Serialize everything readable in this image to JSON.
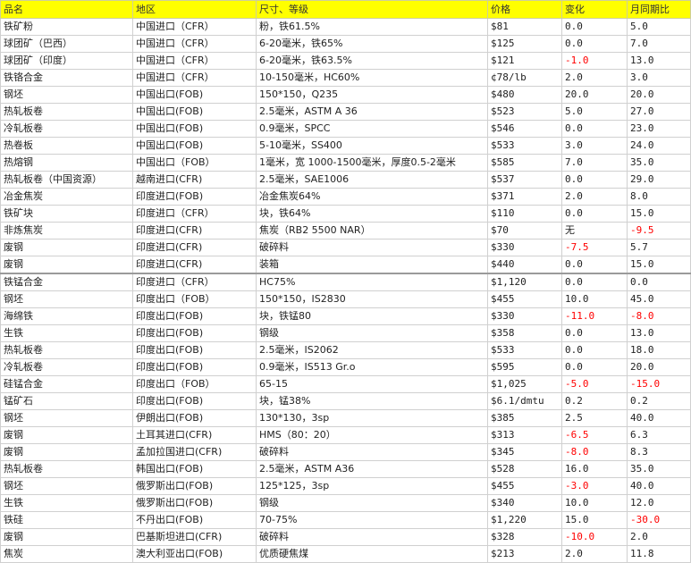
{
  "headers": [
    "品名",
    "地区",
    "尺寸、等级",
    "价格",
    "变化",
    "月同期比"
  ],
  "colors": {
    "header_bg": "#ffff00",
    "negative": "#ff0000",
    "grid": "#d0d0d0"
  },
  "rows": [
    {
      "name": "铁矿粉",
      "region": "中国进口（CFR）",
      "spec": "粉，铁61.5%",
      "price": "$81",
      "change": "0.0",
      "mom": "5.0"
    },
    {
      "name": "球团矿（巴西）",
      "region": "中国进口（CFR）",
      "spec": "6-20毫米，铁65%",
      "price": "$125",
      "change": "0.0",
      "mom": "7.0"
    },
    {
      "name": "球团矿（印度）",
      "region": "中国进口（CFR）",
      "spec": "6-20毫米，铁63.5%",
      "price": "$121",
      "change": "-1.0",
      "mom": "13.0"
    },
    {
      "name": "铁铬合金",
      "region": "中国进口（CFR）",
      "spec": "10-150毫米，HC60%",
      "price": "¢78/lb",
      "change": "2.0",
      "mom": "3.0"
    },
    {
      "name": "钢坯",
      "region": "中国出口(FOB)",
      "spec": "150*150，Q235",
      "price": "$480",
      "change": "20.0",
      "mom": "20.0"
    },
    {
      "name": "热轧板卷",
      "region": "中国出口(FOB)",
      "spec": "2.5毫米，ASTM A 36",
      "price": "$523",
      "change": "5.0",
      "mom": "27.0"
    },
    {
      "name": "冷轧板卷",
      "region": "中国出口(FOB)",
      "spec": "0.9毫米，SPCC",
      "price": "$546",
      "change": "0.0",
      "mom": "23.0"
    },
    {
      "name": "热卷板",
      "region": "中国出口(FOB)",
      "spec": "5-10毫米，SS400",
      "price": "$533",
      "change": "3.0",
      "mom": "24.0"
    },
    {
      "name": "热熔钢",
      "region": "中国出口（FOB）",
      "spec": "1毫米，宽 1000-1500毫米，厚度0.5-2毫米",
      "price": "$585",
      "change": "7.0",
      "mom": "35.0"
    },
    {
      "name": "热轧板卷（中国资源）",
      "region": "越南进口(CFR)",
      "spec": "2.5毫米，SAE1006",
      "price": "$537",
      "change": "0.0",
      "mom": "29.0"
    },
    {
      "name": "冶金焦炭",
      "region": "印度进口(FOB)",
      "spec": "冶金焦炭64%",
      "price": "$371",
      "change": "2.0",
      "mom": "8.0"
    },
    {
      "name": "铁矿块",
      "region": "印度进口（CFR）",
      "spec": "块，铁64%",
      "price": "$110",
      "change": "0.0",
      "mom": "15.0"
    },
    {
      "name": "非炼焦炭",
      "region": "印度进口(CFR)",
      "spec": "焦炭（RB2 5500 NAR）",
      "price": "$70",
      "change": "无",
      "mom": "-9.5"
    },
    {
      "name": "废钢",
      "region": "印度进口(CFR)",
      "spec": "破碎料",
      "price": "$330",
      "change": "-7.5",
      "mom": "5.7"
    },
    {
      "name": "废钢",
      "region": "印度进口(CFR)",
      "spec": "装箱",
      "price": "$440",
      "change": "0.0",
      "mom": "15.0"
    },
    {
      "name": "铁锰合金",
      "region": "印度进口（CFR）",
      "spec": "HC75%",
      "price": "$1,120",
      "change": "0.0",
      "mom": "0.0"
    },
    {
      "name": "钢坯",
      "region": "印度出口（FOB）",
      "spec": "150*150，IS2830",
      "price": "$455",
      "change": "10.0",
      "mom": "45.0"
    },
    {
      "name": "海绵铁",
      "region": "印度出口(FOB)",
      "spec": "块，铁锰80",
      "price": "$330",
      "change": "-11.0",
      "mom": "-8.0"
    },
    {
      "name": "生铁",
      "region": "印度出口(FOB)",
      "spec": "钢级",
      "price": "$358",
      "change": "0.0",
      "mom": "13.0"
    },
    {
      "name": "热轧板卷",
      "region": "印度出口(FOB)",
      "spec": "2.5毫米，IS2062",
      "price": "$533",
      "change": "0.0",
      "mom": "18.0"
    },
    {
      "name": "冷轧板卷",
      "region": "印度出口(FOB)",
      "spec": "0.9毫米，IS513 Gr.o",
      "price": "$595",
      "change": "0.0",
      "mom": "20.0"
    },
    {
      "name": "硅锰合金",
      "region": "印度出口（FOB）",
      "spec": "65-15",
      "price": "$1,025",
      "change": "-5.0",
      "mom": "-15.0"
    },
    {
      "name": "锰矿石",
      "region": "印度出口(FOB)",
      "spec": "块，锰38%",
      "price": "$6.1/dmtu",
      "change": "0.2",
      "mom": "0.2"
    },
    {
      "name": "钢坯",
      "region": "伊朗出口(FOB)",
      "spec": "130*130，3sp",
      "price": "$385",
      "change": "2.5",
      "mom": "40.0"
    },
    {
      "name": "废钢",
      "region": "土耳其进口(CFR)",
      "spec": "HMS（80：20）",
      "price": "$313",
      "change": "-6.5",
      "mom": "6.3"
    },
    {
      "name": "废钢",
      "region": "孟加拉国进口(CFR)",
      "spec": "破碎料",
      "price": "$345",
      "change": "-8.0",
      "mom": "8.3"
    },
    {
      "name": "热轧板卷",
      "region": "韩国出口(FOB)",
      "spec": "2.5毫米，ASTM A36",
      "price": "$528",
      "change": "16.0",
      "mom": "35.0"
    },
    {
      "name": "钢坯",
      "region": "俄罗斯出口(FOB)",
      "spec": "125*125，3sp",
      "price": "$455",
      "change": "-3.0",
      "mom": "40.0"
    },
    {
      "name": "生铁",
      "region": "俄罗斯出口(FOB)",
      "spec": "钢级",
      "price": "$340",
      "change": "10.0",
      "mom": "12.0"
    },
    {
      "name": "铁硅",
      "region": "不丹出口(FOB)",
      "spec": "70-75%",
      "price": "$1,220",
      "change": "15.0",
      "mom": "-30.0"
    },
    {
      "name": "废钢",
      "region": "巴基斯坦进口(CFR)",
      "spec": "破碎料",
      "price": "$328",
      "change": "-10.0",
      "mom": "2.0"
    },
    {
      "name": "焦炭",
      "region": "澳大利亚出口(FOB)",
      "spec": "优质硬焦煤",
      "price": "$213",
      "change": "2.0",
      "mom": "11.8"
    }
  ]
}
